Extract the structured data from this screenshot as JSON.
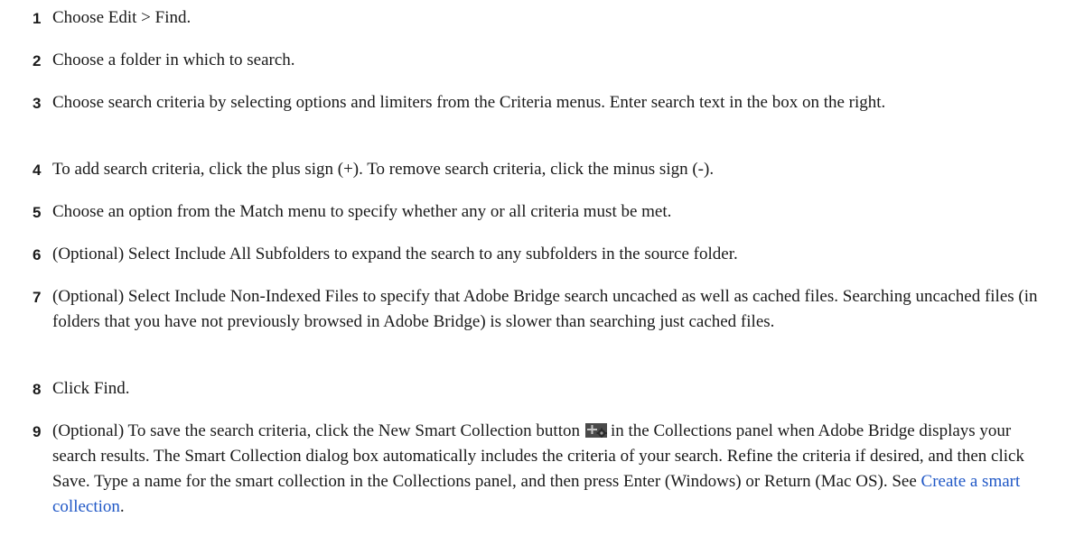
{
  "steps": [
    {
      "number": "1",
      "text": "Choose Edit > Find."
    },
    {
      "number": "2",
      "text": "Choose a folder in which to search."
    },
    {
      "number": "3",
      "text": "Choose search criteria by selecting options and limiters from the Criteria menus. Enter search text in the box on the right."
    },
    {
      "number": "4",
      "text": "To add search criteria, click the plus sign (+). To remove search criteria, click the minus sign (-)."
    },
    {
      "number": "5",
      "text": "Choose an option from the Match menu to specify whether any or all criteria must be met."
    },
    {
      "number": "6",
      "text": "(Optional) Select Include All Subfolders to expand the search to any subfolders in the source folder."
    },
    {
      "number": "7",
      "text": "(Optional) Select Include Non-Indexed Files to specify that Adobe Bridge search uncached as well as cached files. Searching uncached files (in folders that you have not previously browsed in Adobe Bridge) is slower than searching just cached files."
    },
    {
      "number": "8",
      "text": "Click Find."
    },
    {
      "number": "9",
      "text_before_icon": "(Optional) To save the search criteria, click the New Smart Collection button",
      "icon": "new-smart-collection-icon",
      "text_after_icon": "in the Collections panel when Adobe Bridge displays your search results. The Smart Collection dialog box automatically includes the criteria of your search. Refine the criteria if desired, and then click Save. Type a name for the smart collection in the Collections panel, and then press Enter (Windows) or Return (Mac OS). See ",
      "link_text": "Create a smart collection",
      "trailing": "."
    }
  ],
  "colors": {
    "text": "#1a1a1a",
    "link": "#1f57c6"
  }
}
